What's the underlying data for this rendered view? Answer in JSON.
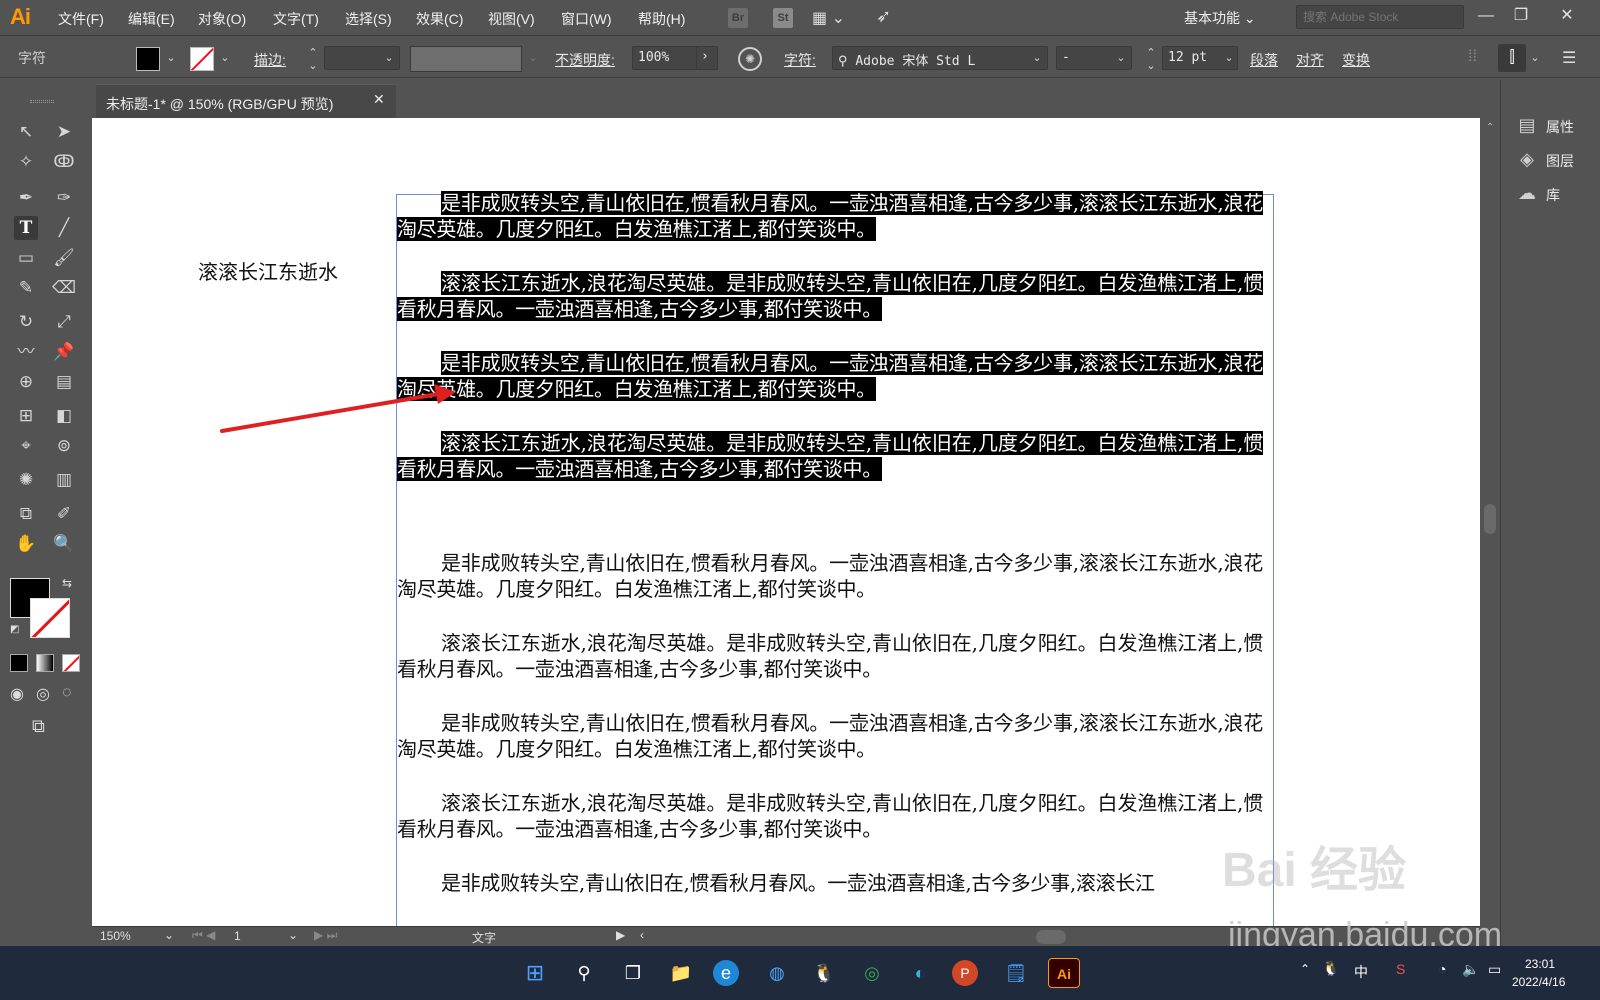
{
  "app": {
    "logo": "Ai",
    "menu": [
      "文件(F)",
      "编辑(E)",
      "对象(O)",
      "文字(T)",
      "选择(S)",
      "效果(C)",
      "视图(V)",
      "窗口(W)",
      "帮助(H)"
    ],
    "bridge_label": "Br",
    "stock_label": "St",
    "workspace": "基本功能",
    "stock_search_placeholder": "搜索 Adobe Stock"
  },
  "controlbar": {
    "panel_name": "字符",
    "stroke_label": "描边:",
    "opacity_label": "不透明度:",
    "opacity_value": "100%",
    "char_label": "字符:",
    "font_name": "Adobe 宋体 Std L",
    "font_style": "-",
    "font_size": "12 pt",
    "paragraph_label": "段落",
    "align_label": "对齐",
    "transform_label": "变换"
  },
  "document": {
    "tab_title": "未标题-1* @ 150% (RGB/GPU 预览)",
    "point_text": "滚滚长江东逝水",
    "paragraphs": [
      {
        "text": "是非成败转头空,青山依旧在,惯看秋月春风。一壶浊酒喜相逢,古今多少事,滚滚长江东逝水,浪花淘尽英雄。几度夕阳红。白发渔樵江渚上,都付笑谈中。",
        "selected": true
      },
      {
        "text": "滚滚长江东逝水,浪花淘尽英雄。是非成败转头空,青山依旧在,几度夕阳红。白发渔樵江渚上,惯看秋月春风。一壶浊酒喜相逢,古今多少事,都付笑谈中。",
        "selected": true
      },
      {
        "text": "是非成败转头空,青山依旧在,惯看秋月春风。一壶浊酒喜相逢,古今多少事,滚滚长江东逝水,浪花淘尽英雄。几度夕阳红。白发渔樵江渚上,都付笑谈中。",
        "selected": true
      },
      {
        "text": "滚滚长江东逝水,浪花淘尽英雄。是非成败转头空,青山依旧在,几度夕阳红。白发渔樵江渚上,惯看秋月春风。一壶浊酒喜相逢,古今多少事,都付笑谈中。",
        "selected": true
      },
      {
        "text": "是非成败转头空,青山依旧在,惯看秋月春风。一壶浊酒喜相逢,古今多少事,滚滚长江东逝水,浪花淘尽英雄。几度夕阳红。白发渔樵江渚上,都付笑谈中。",
        "selected": false
      },
      {
        "text": "滚滚长江东逝水,浪花淘尽英雄。是非成败转头空,青山依旧在,几度夕阳红。白发渔樵江渚上,惯看秋月春风。一壶浊酒喜相逢,古今多少事,都付笑谈中。",
        "selected": false
      },
      {
        "text": "是非成败转头空,青山依旧在,惯看秋月春风。一壶浊酒喜相逢,古今多少事,滚滚长江东逝水,浪花淘尽英雄。几度夕阳红。白发渔樵江渚上,都付笑谈中。",
        "selected": false
      },
      {
        "text": "滚滚长江东逝水,浪花淘尽英雄。是非成败转头空,青山依旧在,几度夕阳红。白发渔樵江渚上,惯看秋月春风。一壶浊酒喜相逢,古今多少事,都付笑谈中。",
        "selected": false
      },
      {
        "text": "是非成败转头空,青山依旧在,惯看秋月春风。一壶浊酒喜相逢,古今多少事,滚滚长江",
        "selected": false
      }
    ]
  },
  "dock": {
    "properties": "属性",
    "layers": "图层",
    "libraries": "库"
  },
  "statusbar": {
    "zoom": "150%",
    "artboard": "1",
    "tool": "文字"
  },
  "taskbar": {
    "ime": "中",
    "time": "23:01",
    "date": "2022/4/16"
  },
  "watermark": {
    "text": "Bai 经验",
    "url": "jingyan.baidu.com"
  },
  "colors": {
    "ui_bg": "#535353",
    "canvas": "#ffffff",
    "selection": "#000000",
    "frame": "#6a8fd8",
    "arrow": "#e02020",
    "accent": "#ff9a00"
  }
}
